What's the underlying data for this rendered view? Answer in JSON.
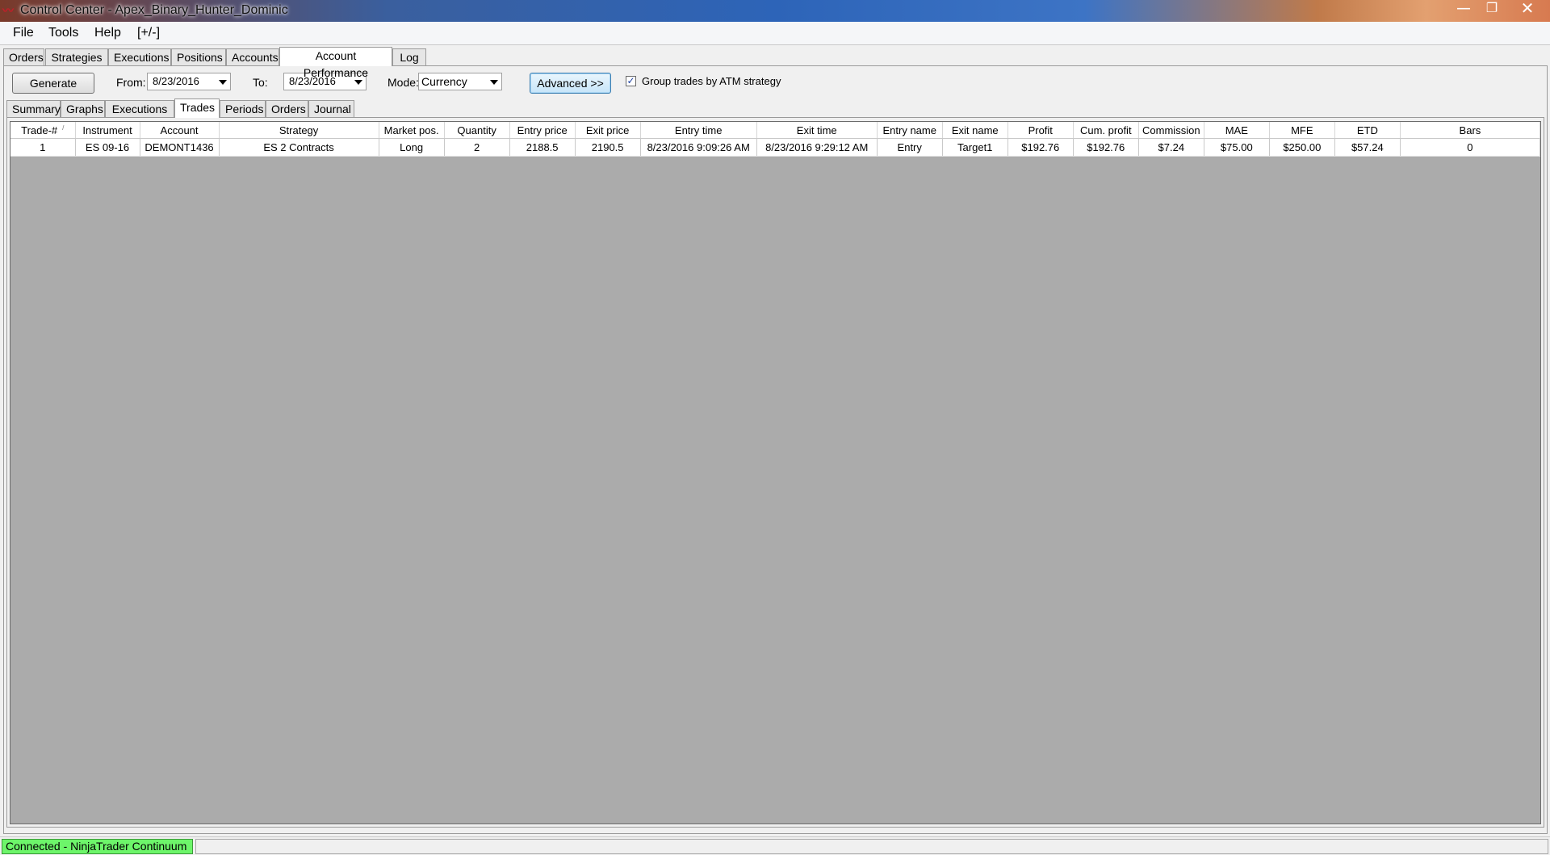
{
  "window": {
    "title": "Control Center - Apex_Binary_Hunter_Dominic",
    "min": "—",
    "max": "❐",
    "close": "✕"
  },
  "menu": [
    "File",
    "Tools",
    "Help",
    "[+/-]"
  ],
  "outer_tabs": [
    "Orders",
    "Strategies",
    "Executions",
    "Positions",
    "Accounts",
    "Account Performance",
    "Log"
  ],
  "controls": {
    "generate": "Generate",
    "from_label": "From:",
    "from_value": "8/23/2016",
    "to_label": "To:",
    "to_value": "8/23/2016",
    "mode_label": "Mode:",
    "mode_value": "Currency",
    "advanced": "Advanced >>",
    "group_checked": "✓",
    "group_label": "Group trades by ATM strategy"
  },
  "inner_tabs": [
    "Summary",
    "Graphs",
    "Executions",
    "Trades",
    "Periods",
    "Orders",
    "Journal"
  ],
  "table": {
    "columns": [
      "Trade-#",
      "Instrument",
      "Account",
      "Strategy",
      "Market pos.",
      "Quantity",
      "Entry price",
      "Exit price",
      "Entry time",
      "Exit time",
      "Entry name",
      "Exit name",
      "Profit",
      "Cum. profit",
      "Commission",
      "MAE",
      "MFE",
      "ETD",
      "Bars"
    ],
    "sort_indicator": "/",
    "rows": [
      [
        "1",
        "ES 09-16",
        "DEMONT1436",
        "ES 2 Contracts",
        "Long",
        "2",
        "2188.5",
        "2190.5",
        "8/23/2016 9:09:26 AM",
        "8/23/2016 9:29:12 AM",
        "Entry",
        "Target1",
        "$192.76",
        "$192.76",
        "$7.24",
        "$75.00",
        "$250.00",
        "$57.24",
        "0"
      ]
    ]
  },
  "status": {
    "connection": "Connected - NinjaTrader Continuum"
  },
  "colors": {
    "status_connected": "#6df56a",
    "grid_background": "#ababab"
  }
}
